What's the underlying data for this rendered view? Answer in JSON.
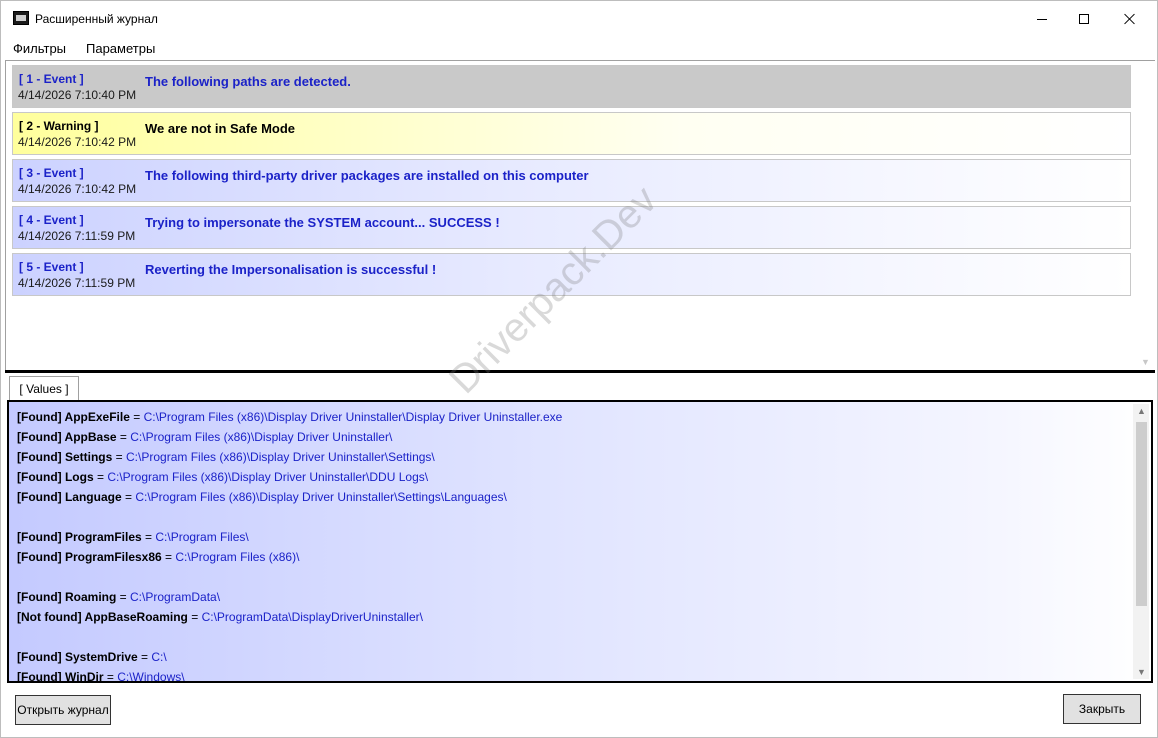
{
  "window": {
    "title": "Расширенный журнал",
    "icon": "ddu-app-icon"
  },
  "menu": {
    "items": [
      "Фильтры",
      "Параметры"
    ]
  },
  "log": {
    "entries": [
      {
        "tag": "[ 1 - Event ]",
        "time": "4/14/2026 7:10:40 PM",
        "message": "The following paths are detected.",
        "style": "selected-gray"
      },
      {
        "tag": "[ 2 - Warning ]",
        "time": "4/14/2026 7:10:42 PM",
        "message": "We are not in Safe Mode",
        "style": "warning-yellow"
      },
      {
        "tag": "[ 3 - Event ]",
        "time": "4/14/2026 7:10:42 PM",
        "message": "The following third-party driver packages are installed on this computer",
        "style": "event-blue"
      },
      {
        "tag": "[ 4 - Event ]",
        "time": "4/14/2026 7:11:59 PM",
        "message": "Trying to impersonate the SYSTEM account... SUCCESS !",
        "style": "event-blue"
      },
      {
        "tag": "[ 5 - Event ]",
        "time": "4/14/2026 7:11:59 PM",
        "message": "Reverting the Impersonalisation is successful !",
        "style": "event-blue"
      }
    ]
  },
  "values_tab": {
    "label": "[ Values ]",
    "lines": [
      {
        "key": "[Found] AppExeFile",
        "eq": " = ",
        "path": "C:\\Program Files (x86)\\Display Driver Uninstaller\\Display Driver Uninstaller.exe"
      },
      {
        "key": "[Found] AppBase",
        "eq": " = ",
        "path": "C:\\Program Files (x86)\\Display Driver Uninstaller\\"
      },
      {
        "key": "[Found] Settings",
        "eq": " = ",
        "path": "C:\\Program Files (x86)\\Display Driver Uninstaller\\Settings\\"
      },
      {
        "key": "[Found] Logs",
        "eq": " = ",
        "path": "C:\\Program Files (x86)\\Display Driver Uninstaller\\DDU Logs\\"
      },
      {
        "key": "[Found] Language",
        "eq": " = ",
        "path": "C:\\Program Files (x86)\\Display Driver Uninstaller\\Settings\\Languages\\"
      },
      {
        "key": "[Found] ProgramFiles",
        "eq": " = ",
        "path": "C:\\Program Files\\"
      },
      {
        "key": "[Found] ProgramFilesx86",
        "eq": " = ",
        "path": "C:\\Program Files (x86)\\"
      },
      {
        "key": "[Found] Roaming",
        "eq": " = ",
        "path": "C:\\ProgramData\\"
      },
      {
        "key": "[Not found] AppBaseRoaming",
        "eq": " = ",
        "path": "C:\\ProgramData\\DisplayDriverUninstaller\\"
      },
      {
        "key": "[Found] SystemDrive",
        "eq": " = ",
        "path": "C:\\"
      },
      {
        "key": "[Found] WinDir",
        "eq": " = ",
        "path": "C:\\Windows\\"
      }
    ]
  },
  "buttons": {
    "open_log": "Открыть журнал",
    "close": "Закрыть"
  },
  "watermark": "Driverpack.Dev",
  "colors": {
    "event_text": "#1b22c8",
    "warning_bg": "#ffff9c",
    "selected_bg": "#c9c9c9",
    "event_bg": "#ccd2ff"
  }
}
